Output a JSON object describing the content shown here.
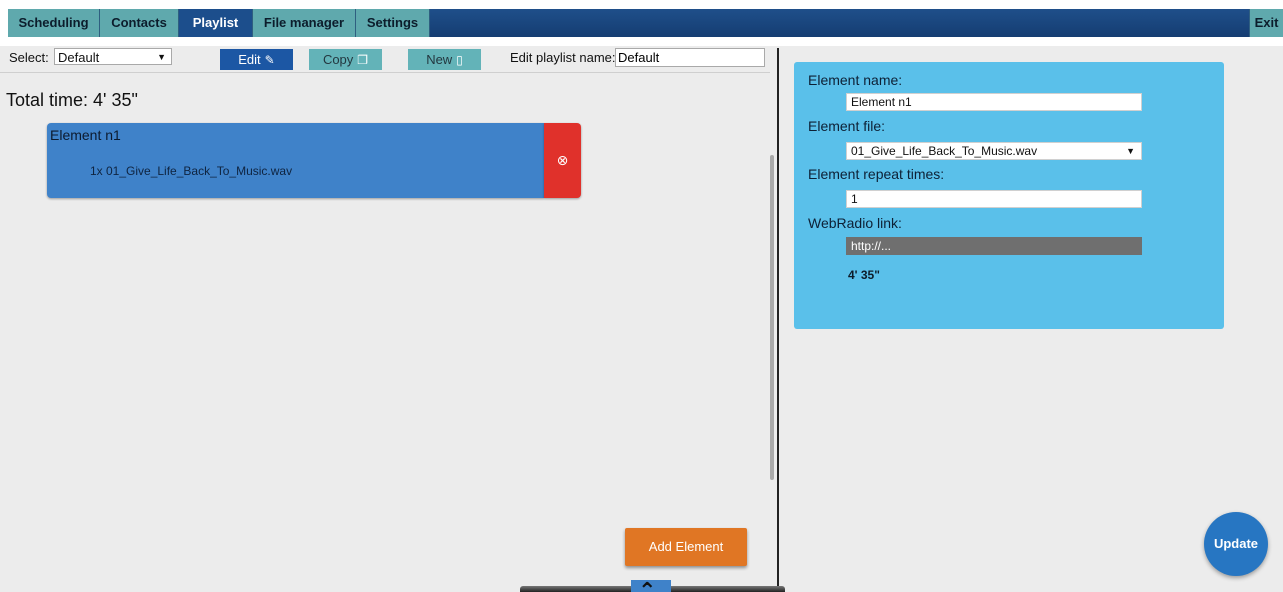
{
  "nav": {
    "tabs": [
      {
        "label": "Scheduling"
      },
      {
        "label": "Contacts"
      },
      {
        "label": "Playlist",
        "active": true
      },
      {
        "label": "File manager"
      },
      {
        "label": "Settings"
      }
    ],
    "exit_label": "Exit"
  },
  "toolbar": {
    "select_label": "Select:",
    "select_value": "Default",
    "edit_label": "Edit",
    "copy_label": "Copy",
    "new_label": "New",
    "playlist_name_label": "Edit playlist name:",
    "playlist_name_value": "Default"
  },
  "playlist": {
    "total_time": "Total time: 4' 35\"",
    "elements": [
      {
        "name": "Element n1",
        "file_line": "1x 01_Give_Life_Back_To_Music.wav"
      }
    ],
    "add_label": "Add Element"
  },
  "panel": {
    "name_label": "Element name:",
    "name_value": "Element n1",
    "file_label": "Element file:",
    "file_value": "01_Give_Life_Back_To_Music.wav",
    "repeat_label": "Element repeat times:",
    "repeat_value": "1",
    "webradio_label": "WebRadio link:",
    "webradio_placeholder": "http://...",
    "duration": "4' 35\""
  },
  "update_label": "Update",
  "colors": {
    "nav_bg": "#1c4e8c",
    "tab_bg": "#5fa9ad",
    "element_card": "#3f82c9",
    "delete": "#e0312b",
    "panel": "#5ac0ea",
    "add_button": "#e07624",
    "update_button": "#2776c2"
  },
  "icons": {
    "edit": "pencil-square-icon",
    "copy": "copy-icon",
    "new": "new-file-icon",
    "delete": "close-circle-icon",
    "up": "chevron-up-icon"
  }
}
